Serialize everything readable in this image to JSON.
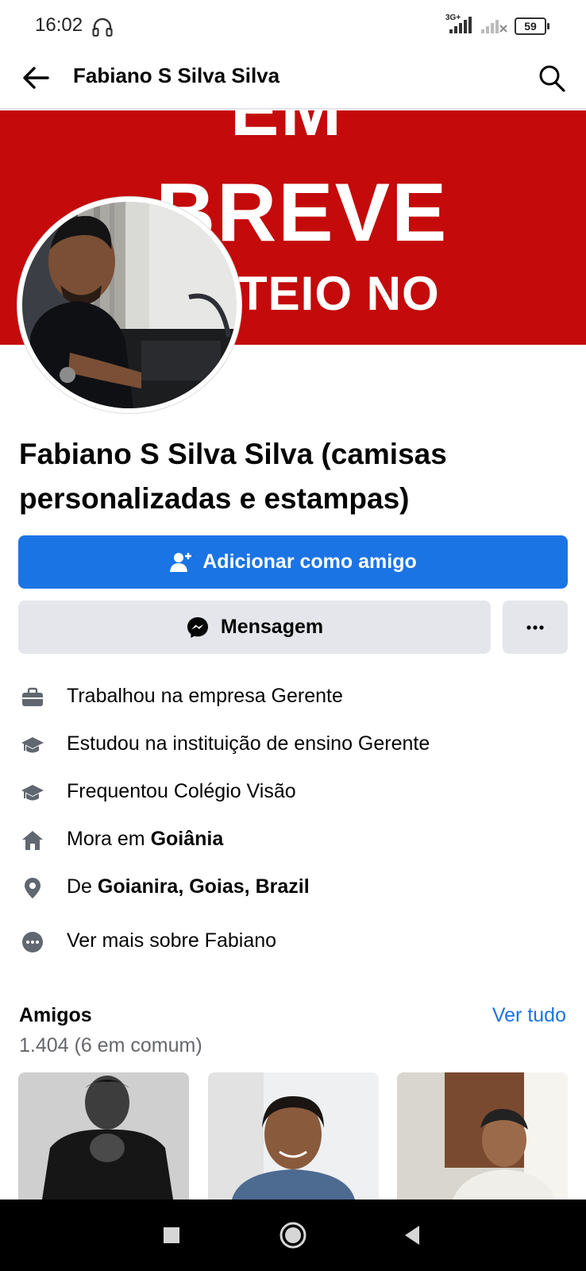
{
  "status_bar": {
    "time": "16:02",
    "network_type": "3G+",
    "battery": "59",
    "icons": [
      "headset-icon",
      "signal-icon",
      "no-signal-icon",
      "battery-icon"
    ]
  },
  "nav": {
    "title": "Fabiano S Silva Silva",
    "icons": [
      "back-arrow-icon",
      "search-icon"
    ]
  },
  "cover": {
    "lines": [
      "EM",
      "BREVE",
      "TEIO NO"
    ],
    "color": "#c40a0b"
  },
  "profile": {
    "name": "Fabiano S Silva Silva (camisas personalizadas e estampas)"
  },
  "actions": {
    "add_friend": "Adicionar como amigo",
    "message": "Mensagem",
    "more_icon": "more-dots-icon"
  },
  "info": [
    {
      "icon": "briefcase-icon",
      "text": "Trabalhou na empresa Gerente"
    },
    {
      "icon": "graduation-cap-icon",
      "text": "Estudou na instituição de ensino Gerente"
    },
    {
      "icon": "graduation-cap-icon",
      "text": "Frequentou Colégio Visão"
    },
    {
      "icon": "home-icon",
      "prefix": "Mora em ",
      "bold": "Goiânia"
    },
    {
      "icon": "location-pin-icon",
      "prefix": "De ",
      "bold": "Goianira, Goias, Brazil"
    },
    {
      "icon": "more-circle-icon",
      "text": "Ver mais sobre Fabiano"
    }
  ],
  "friends": {
    "title": "Amigos",
    "see_all": "Ver tudo",
    "count": "1.404 (6 em comum)"
  },
  "colors": {
    "primary": "#1b74e4",
    "secondary_button": "#e4e6eb",
    "text": "#050505",
    "muted": "#65676b"
  }
}
